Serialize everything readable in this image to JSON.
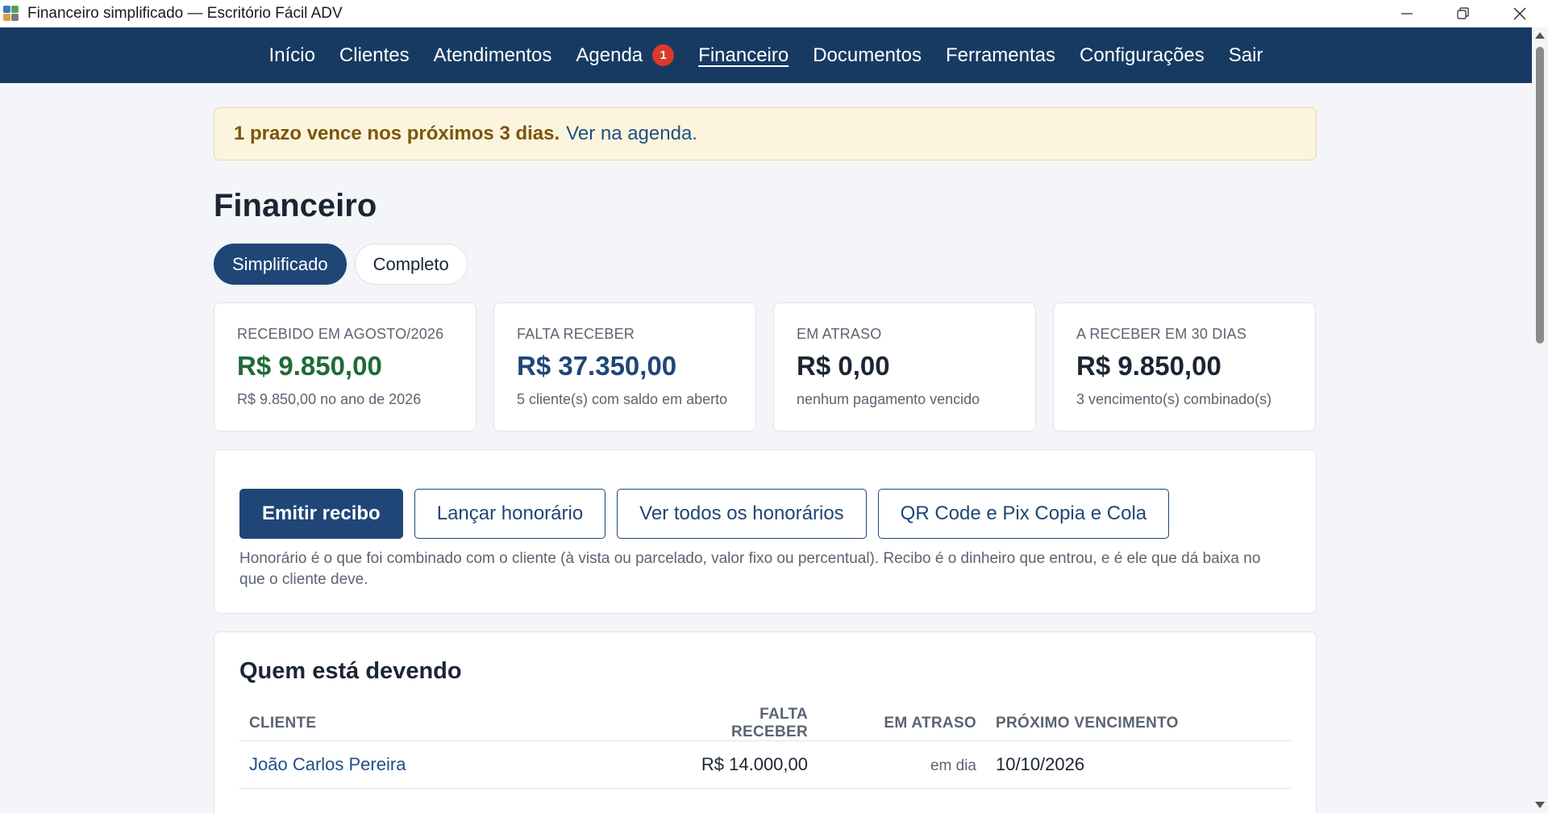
{
  "window": {
    "title": "Financeiro simplificado — Escritório Fácil ADV"
  },
  "nav": {
    "items": [
      {
        "label": "Início"
      },
      {
        "label": "Clientes"
      },
      {
        "label": "Atendimentos"
      },
      {
        "label": "Agenda",
        "badge": "1"
      },
      {
        "label": "Financeiro",
        "active": true
      },
      {
        "label": "Documentos"
      },
      {
        "label": "Ferramentas"
      },
      {
        "label": "Configurações"
      },
      {
        "label": "Sair"
      }
    ]
  },
  "alert": {
    "message": "1 prazo vence nos próximos 3 dias.",
    "link": "Ver na agenda."
  },
  "page": {
    "title": "Financeiro",
    "tabs": [
      {
        "label": "Simplificado",
        "active": true
      },
      {
        "label": "Completo",
        "active": false
      }
    ]
  },
  "stats": [
    {
      "label": "RECEBIDO EM AGOSTO/2026",
      "value": "R$ 9.850,00",
      "sub": "R$ 9.850,00 no ano de 2026",
      "color": "#1f6b35"
    },
    {
      "label": "FALTA RECEBER",
      "value": "R$ 37.350,00",
      "sub": "5 cliente(s) com saldo em aberto",
      "color": "#1f4677"
    },
    {
      "label": "EM ATRASO",
      "value": "R$ 0,00",
      "sub": "nenhum pagamento vencido",
      "color": "#1b2533"
    },
    {
      "label": "A RECEBER EM 30 DIAS",
      "value": "R$ 9.850,00",
      "sub": "3 vencimento(s) combinado(s)",
      "color": "#1b2533"
    }
  ],
  "actions": {
    "emit_receipt": "Emitir recibo",
    "add_fee": "Lançar honorário",
    "view_fees": "Ver todos os honorários",
    "pix": "QR Code e Pix Copia e Cola",
    "help": "Honorário é o que foi combinado com o cliente (à vista ou parcelado, valor fixo ou percentual). Recibo é o dinheiro que entrou, e é ele que dá baixa no que o cliente deve."
  },
  "debtors": {
    "title": "Quem está devendo",
    "columns": [
      "CLIENTE",
      "FALTA RECEBER",
      "EM ATRASO",
      "PRÓXIMO VENCIMENTO"
    ],
    "rows": [
      {
        "client": "João Carlos Pereira",
        "remaining": "R$ 14.000,00",
        "overdue": "em dia",
        "next_due": "10/10/2026"
      }
    ]
  },
  "colors": {
    "navbar": "#173a63",
    "primary": "#1f4677",
    "badge": "#d93a2b",
    "alert_bg": "#fcf4dd"
  }
}
